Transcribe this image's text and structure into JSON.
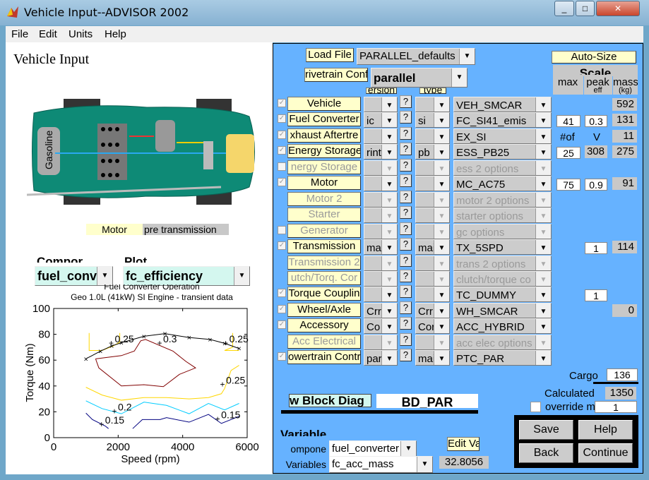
{
  "window": {
    "title": "Vehicle Input--ADVISOR 2002",
    "controls": [
      "_",
      "□",
      "✕"
    ]
  },
  "menu": [
    "File",
    "Edit",
    "Units",
    "Help"
  ],
  "left": {
    "heading": "Vehicle Input",
    "image_label": "Gasoline",
    "motor_label": "Motor",
    "motor_position": "pre transmission",
    "component_label": "Compor",
    "plot_label": "Plot",
    "component_select": "fuel_conv",
    "plot_select": "fc_efficiency"
  },
  "plot": {
    "title": "Fuel Converter Operation",
    "subtitle": "Geo 1.0L (41kW) SI Engine - transient data",
    "xlabel": "Speed (rpm)",
    "ylabel": "Torque (Nm)",
    "xlim": [
      0,
      6000
    ],
    "ylim": [
      0,
      100
    ],
    "xticks": [
      "0",
      "2000",
      "4000",
      "6000"
    ],
    "yticks": [
      "0",
      "20",
      "40",
      "60",
      "80",
      "100"
    ],
    "max_torque": [
      [
        1000,
        61
      ],
      [
        1450,
        67
      ],
      [
        1800,
        71
      ],
      [
        2100,
        73.5
      ],
      [
        2800,
        78.5
      ],
      [
        3450,
        80.5
      ],
      [
        4200,
        77.5
      ],
      [
        4850,
        76
      ],
      [
        5300,
        73
      ],
      [
        5750,
        69
      ]
    ],
    "contours": [
      {
        "level": "0.3",
        "color": "#800000",
        "points": [
          [
            1300,
            61
          ],
          [
            2100,
            63.5
          ],
          [
            2500,
            67
          ],
          [
            2700,
            75
          ],
          [
            2850,
            76
          ],
          [
            3700,
            67
          ],
          [
            4100,
            59
          ],
          [
            4400,
            54
          ],
          [
            3900,
            49
          ],
          [
            3400,
            39.5
          ],
          [
            2800,
            41
          ],
          [
            2100,
            40
          ],
          [
            1400,
            54
          ],
          [
            1300,
            61
          ]
        ]
      },
      {
        "level": "0.25",
        "color": "#ffd700",
        "points": [
          [
            1000,
            39
          ],
          [
            1500,
            33
          ],
          [
            2100,
            29
          ],
          [
            2800,
            31
          ],
          [
            3500,
            31
          ],
          [
            4200,
            30
          ],
          [
            4800,
            31
          ],
          [
            5200,
            34
          ],
          [
            5300,
            38
          ],
          [
            5500,
            52
          ],
          [
            5750,
            56
          ]
        ]
      },
      {
        "level": "0.25",
        "color": "#ffd700",
        "points": [
          [
            1100,
            81
          ],
          [
            1100,
            67.5
          ],
          [
            1500,
            67.5
          ],
          [
            1850,
            71
          ],
          [
            2050,
            74
          ],
          [
            2050,
            81
          ]
        ]
      },
      {
        "level": "0.25",
        "color": "#ffd700",
        "points": [
          [
            5550,
            81
          ],
          [
            5550,
            70
          ],
          [
            5300,
            67.5
          ],
          [
            5750,
            67.5
          ]
        ]
      },
      {
        "level": "0.2",
        "color": "#00ccff",
        "points": [
          [
            1000,
            28.5
          ],
          [
            1500,
            22.5
          ],
          [
            2100,
            18.5
          ],
          [
            2800,
            27.5
          ],
          [
            3500,
            25
          ],
          [
            4200,
            18.5
          ],
          [
            4800,
            26.5
          ],
          [
            5300,
            21.5
          ],
          [
            5750,
            26.5
          ]
        ]
      },
      {
        "level": "0.15",
        "color": "#000080",
        "points": [
          [
            1000,
            19
          ],
          [
            1200,
            14
          ],
          [
            1600,
            9
          ],
          [
            1700,
            7
          ]
        ]
      },
      {
        "level": "0.15",
        "color": "#000080",
        "points": [
          [
            2450,
            7
          ],
          [
            2750,
            14
          ],
          [
            3300,
            14
          ],
          [
            3500,
            15.5
          ],
          [
            4200,
            12
          ],
          [
            4800,
            18
          ],
          [
            5200,
            11
          ],
          [
            5750,
            16.5
          ]
        ]
      }
    ],
    "labels": [
      {
        "text": "0.25",
        "x": 1850,
        "y": 75
      },
      {
        "text": "0.3",
        "x": 3350,
        "y": 75
      },
      {
        "text": "0.25",
        "x": 5400,
        "y": 75
      },
      {
        "text": "0.25",
        "x": 5300,
        "y": 43
      },
      {
        "text": "0.2",
        "x": 1950,
        "y": 22
      },
      {
        "text": "0.15",
        "x": 1550,
        "y": 12
      },
      {
        "text": "0.15",
        "x": 5150,
        "y": 16
      }
    ]
  },
  "right": {
    "load_file": "Load File",
    "file_select": "PARALLEL_defaults",
    "drivetrain_label": "rivetrain Conf",
    "drivetrain_select": "parallel",
    "version_header": "ersion",
    "type_header": "type",
    "autosize": "Auto-Size",
    "scale": "Scale",
    "max": "max",
    "peak": "peak",
    "mass": "mass",
    "fc_sub": "eff",
    "mass_sub": "(kg)",
    "nof": "#of",
    "v": "V",
    "rows": [
      {
        "name": "Vehicle",
        "check": true,
        "enabled": true,
        "version": "",
        "type": "",
        "file": "VEH_SMCAR",
        "max": "",
        "peak": "",
        "mass": "592"
      },
      {
        "name": "Fuel Converter",
        "check": true,
        "enabled": true,
        "version": "ic",
        "type": "si",
        "file": "FC_SI41_emis",
        "max": "41",
        "peak": "0.3",
        "mass": "131"
      },
      {
        "name": "xhaust Aftertre",
        "check": true,
        "enabled": true,
        "version": "",
        "type": "",
        "file": "EX_SI",
        "max": "",
        "peak": "",
        "mass": "11"
      },
      {
        "name": "Energy Storage",
        "check": true,
        "enabled": true,
        "version": "rint",
        "type": "pb",
        "file": "ESS_PB25",
        "max": "25",
        "peakro": "308",
        "mass": "275"
      },
      {
        "name": "nergy Storage",
        "check": false,
        "enabled": false,
        "version": "",
        "type": "",
        "file": "ess 2 options",
        "max": "",
        "peak": "",
        "mass": ""
      },
      {
        "name": "Motor",
        "check": true,
        "enabled": true,
        "version": "",
        "type": "",
        "file": "MC_AC75",
        "max": "75",
        "peak": "0.9",
        "mass": "91"
      },
      {
        "name": "Motor 2",
        "check": null,
        "enabled": false,
        "version": "",
        "type": "",
        "file": "motor 2 options",
        "max": "",
        "peak": "",
        "mass": ""
      },
      {
        "name": "Starter",
        "check": null,
        "enabled": false,
        "version": "",
        "type": "",
        "file": "starter options",
        "max": "",
        "peak": "",
        "mass": ""
      },
      {
        "name": "Generator",
        "check": false,
        "enabled": false,
        "version": "",
        "type": "",
        "file": " gc options",
        "max": "",
        "peak": "",
        "mass": ""
      },
      {
        "name": "Transmission",
        "check": true,
        "enabled": true,
        "version": "ma",
        "type": "mai",
        "file": "TX_5SPD",
        "max": "",
        "peak": "1",
        "mass": "114"
      },
      {
        "name": "Transmission 2",
        "check": null,
        "enabled": false,
        "version": "",
        "type": "",
        "file": "trans 2 options",
        "max": "",
        "peak": "",
        "mass": ""
      },
      {
        "name": "utch/Torq. Cor",
        "check": null,
        "enabled": false,
        "version": "",
        "type": "",
        "file": "clutch/torque co",
        "max": "",
        "peak": "",
        "mass": ""
      },
      {
        "name": "Torque Couplin",
        "check": true,
        "enabled": true,
        "version": "",
        "type": "",
        "file": "TC_DUMMY",
        "max": "",
        "peak": "1",
        "mass": ""
      },
      {
        "name": "Wheel/Axle",
        "check": true,
        "enabled": true,
        "version": "Crr",
        "type": "Crr",
        "file": "WH_SMCAR",
        "max": "",
        "peak": "",
        "mass": "0"
      },
      {
        "name": "Accessory",
        "check": true,
        "enabled": true,
        "version": "Co",
        "type": "Cor",
        "file": "ACC_HYBRID",
        "max": "",
        "peak": "",
        "mass": ""
      },
      {
        "name": "Acc Electrical",
        "check": null,
        "enabled": false,
        "version": "",
        "type": "",
        "file": "acc elec options",
        "max": "",
        "peak": "",
        "mass": ""
      },
      {
        "name": "owertrain Contr",
        "check": true,
        "enabled": true,
        "version": "par",
        "type": "mai",
        "file": "PTC_PAR",
        "max": "",
        "peak": "",
        "mass": ""
      }
    ],
    "cargo_label": "Cargo",
    "cargo": "136",
    "calculated_label": "Calculated",
    "calculated": "1350",
    "override_label": "override m",
    "override": "1",
    "block_diag": "w Block Diag",
    "bd_name": "BD_PAR",
    "variable_heading": "Variable",
    "component_label": "ompone",
    "component": "fuel_converter",
    "variable_label": "Variables",
    "variable": "fc_acc_mass",
    "edit_value": "Edit Va",
    "value": "32.8056",
    "save": "Save",
    "help": "Help",
    "back": "Back",
    "continue": "Continue"
  }
}
